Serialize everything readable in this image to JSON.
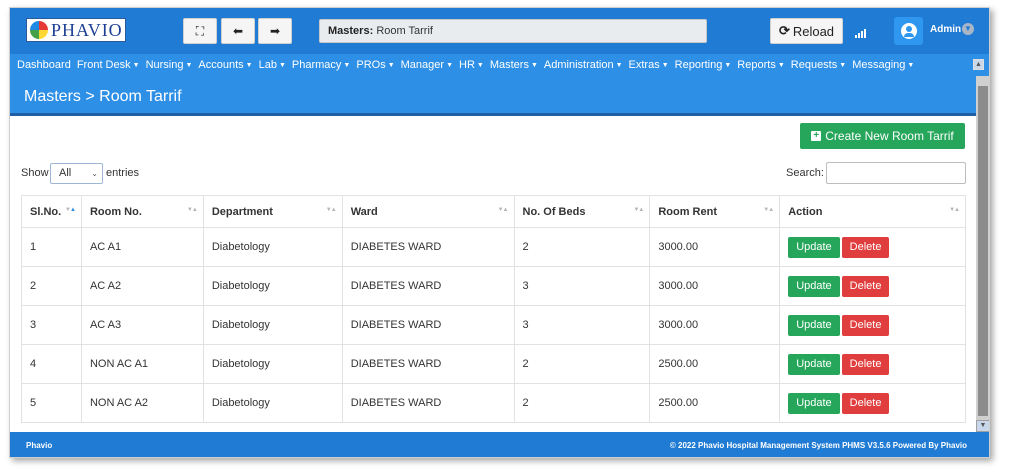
{
  "brand": {
    "name": "PHAVIO"
  },
  "toolbar": {
    "expand_icon": "⛶",
    "back_icon": "⬅",
    "forward_icon": "➡",
    "reload_label": "Reload"
  },
  "breadcrumb": {
    "section": "Masters:",
    "page": "Room Tarrif"
  },
  "user": {
    "name": "Admin"
  },
  "nav": [
    {
      "label": "Dashboard",
      "caret": false
    },
    {
      "label": "Front Desk",
      "caret": true
    },
    {
      "label": "Nursing",
      "caret": true
    },
    {
      "label": "Accounts",
      "caret": true
    },
    {
      "label": "Lab",
      "caret": true
    },
    {
      "label": "Pharmacy",
      "caret": true
    },
    {
      "label": "PROs",
      "caret": true
    },
    {
      "label": "Manager",
      "caret": true
    },
    {
      "label": "HR",
      "caret": true
    },
    {
      "label": "Masters",
      "caret": true
    },
    {
      "label": "Administration",
      "caret": true
    },
    {
      "label": "Extras",
      "caret": true
    },
    {
      "label": "Reporting",
      "caret": true
    },
    {
      "label": "Reports",
      "caret": true
    },
    {
      "label": "Requests",
      "caret": true
    },
    {
      "label": "Messaging",
      "caret": true
    }
  ],
  "page_header": {
    "title": "Masters > Room Tarrif"
  },
  "actions": {
    "create_label": "Create New Room Tarrif"
  },
  "table_controls": {
    "show_label": "Show",
    "show_value": "All",
    "entries_label": "entries",
    "search_label": "Search:"
  },
  "table": {
    "columns": [
      "Sl.No.",
      "Room No.",
      "Department",
      "Ward",
      "No. Of Beds",
      "Room Rent",
      "Action"
    ],
    "rows": [
      {
        "sl": "1",
        "room": "AC A1",
        "dept": "Diabetology",
        "ward": "DIABETES WARD",
        "beds": "2",
        "rent": "3000.00"
      },
      {
        "sl": "2",
        "room": "AC A2",
        "dept": "Diabetology",
        "ward": "DIABETES WARD",
        "beds": "3",
        "rent": "3000.00"
      },
      {
        "sl": "3",
        "room": "AC A3",
        "dept": "Diabetology",
        "ward": "DIABETES WARD",
        "beds": "3",
        "rent": "3000.00"
      },
      {
        "sl": "4",
        "room": "NON AC A1",
        "dept": "Diabetology",
        "ward": "DIABETES WARD",
        "beds": "2",
        "rent": "2500.00"
      },
      {
        "sl": "5",
        "room": "NON AC A2",
        "dept": "Diabetology",
        "ward": "DIABETES WARD",
        "beds": "2",
        "rent": "2500.00"
      }
    ],
    "update_label": "Update",
    "delete_label": "Delete"
  },
  "footer": {
    "left": "Phavio",
    "right": "© 2022 Phavio Hospital Management System PHMS V3.5.6 Powered By Phavio"
  },
  "colors": {
    "topbar": "#1f7bd3",
    "nav": "#2e8fe6",
    "success": "#26a65b",
    "danger": "#e03e3e"
  }
}
